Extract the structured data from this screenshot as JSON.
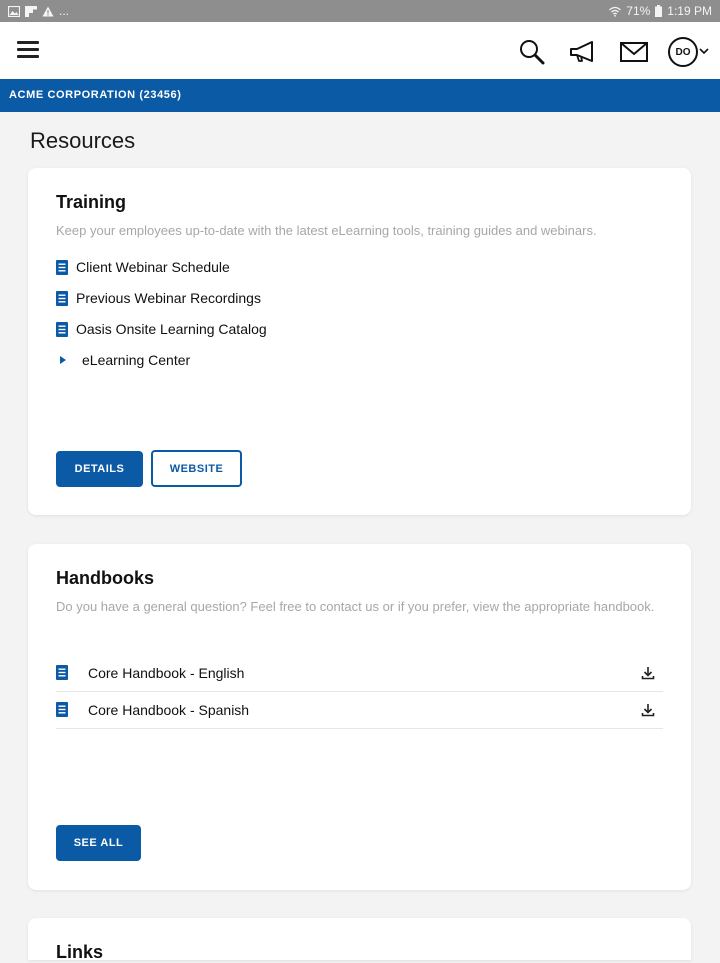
{
  "status_bar": {
    "left_text": "...",
    "battery": "71%",
    "time": "1:19 PM"
  },
  "header": {
    "avatar_initials": "DO",
    "icons": [
      "menu-icon",
      "search-icon",
      "megaphone-icon",
      "mail-icon",
      "avatar",
      "chevron-down-icon"
    ]
  },
  "company": {
    "name": "ACME CORPORATION (23456)"
  },
  "page": {
    "title": "Resources"
  },
  "training": {
    "title": "Training",
    "description": "Keep your employees up-to-date with the latest eLearning tools, training guides and webinars.",
    "items": [
      {
        "label": "Client Webinar Schedule",
        "icon": "document-icon"
      },
      {
        "label": "Previous Webinar Recordings",
        "icon": "document-icon"
      },
      {
        "label": "Oasis Onsite Learning Catalog",
        "icon": "document-icon"
      },
      {
        "label": "eLearning Center",
        "icon": "caret-right-icon"
      }
    ],
    "details_label": "DETAILS",
    "website_label": "WEBSITE"
  },
  "handbooks": {
    "title": "Handbooks",
    "description": "Do you have a general question? Feel free to contact us or if you prefer, view the appropriate handbook.",
    "items": [
      {
        "label": "Core Handbook - English",
        "icon": "document-icon"
      },
      {
        "label": "Core Handbook - Spanish",
        "icon": "document-icon"
      }
    ],
    "see_all_label": "SEE ALL"
  },
  "links": {
    "title": "Links"
  },
  "colors": {
    "primary": "#0b5aa6",
    "background": "#f3f3f3",
    "card": "#ffffff",
    "muted_text": "#a7a7a7",
    "status_bar": "#8e8e8e"
  }
}
